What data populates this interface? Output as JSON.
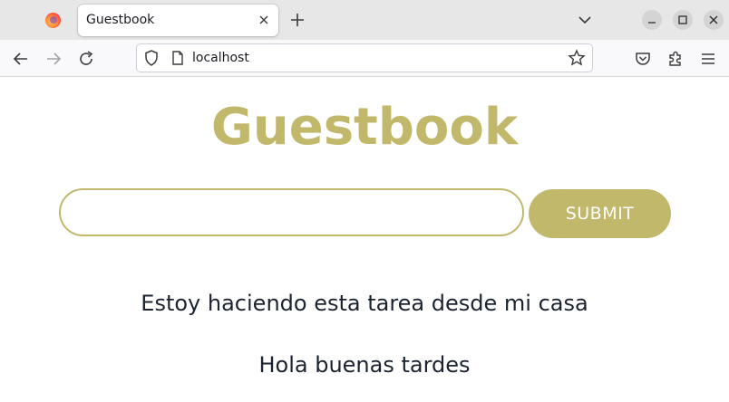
{
  "browser": {
    "tab_title": "Guestbook",
    "url": "localhost",
    "icons": {
      "tab_icon": "firefox-logo",
      "close_tab": "close-icon",
      "new_tab": "plus-icon",
      "tab_list": "chevron-down-icon",
      "back": "arrow-left-icon",
      "forward": "arrow-right-icon",
      "reload": "reload-icon",
      "tracking": "shield-icon",
      "page_info": "page-icon",
      "bookmark": "star-icon",
      "pocket": "pocket-icon",
      "extensions": "puzzle-icon",
      "menu": "hamburger-menu-icon",
      "minimize": "minimize-icon",
      "maximize": "maximize-icon",
      "close_window": "close-window-icon"
    }
  },
  "page": {
    "title": "Guestbook",
    "input_value": "",
    "submit_label": "SUBMIT",
    "entries": [
      "Estoy haciendo esta tarea desde mi casa",
      "Hola buenas tardes"
    ]
  },
  "colors": {
    "accent": "#c2b86c",
    "text": "#1c2330",
    "tabstrip_bg": "#e7e7e7",
    "navbar_bg": "#f9f9fb"
  }
}
